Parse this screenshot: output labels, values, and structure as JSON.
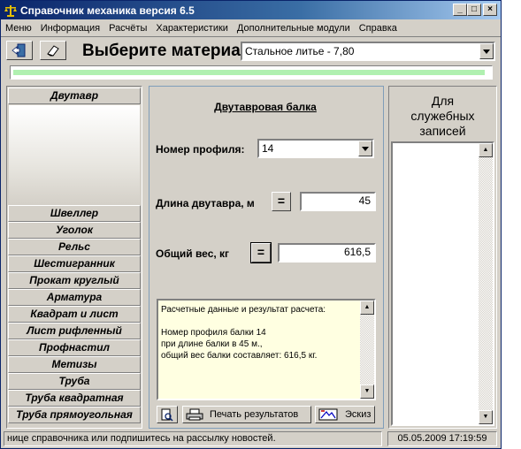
{
  "window": {
    "title": "Справочник механика версия 6.5",
    "minimize_glyph": "_",
    "maximize_glyph": "□",
    "close_glyph": "×"
  },
  "menu": [
    "Меню",
    "Информация",
    "Расчёты",
    "Характеристики",
    "Дополнительные модули",
    "Справка"
  ],
  "toolbar": {
    "exit_icon": "exit-door-icon",
    "eraser_icon": "eraser-icon",
    "material_label": "Выберите материал",
    "material_value": "Стальное литье - 7,80"
  },
  "progress": {
    "fraction": 0.99
  },
  "left_panel": {
    "items": [
      "Двутавр",
      "Швеллер",
      "Уголок",
      "Рельс",
      "Шестигранник",
      "Прокат круглый",
      "Арматура",
      "Квадрат и лист",
      "Лист рифленный",
      "Профнастил",
      "Метизы",
      "Труба",
      "Труба квадратная",
      "Труба прямоугольная"
    ]
  },
  "form": {
    "heading": "Двутавровая балка",
    "profile_label": "Номер профиля:",
    "profile_value": "14",
    "length_label": "Длина двутавра, м",
    "length_value": "45",
    "weight_label": "Общий вес, кг",
    "weight_value": "616,5",
    "eq_label": "=",
    "memo_text": "Расчетные данные и результат расчета:\n\nНомер профиля балки 14\nпри длине балки в 45 м.,\nобщий вес балки составляет: 616,5 кг.",
    "print_label": "Печать результатов",
    "sketch_label": "Эскиз"
  },
  "right_panel": {
    "title": "Для\nслужебных\nзаписей"
  },
  "status": {
    "message": "ницe справочника или подпишитесь на рассылку новостей.",
    "datetime": "05.05.2009 17:19:59"
  }
}
